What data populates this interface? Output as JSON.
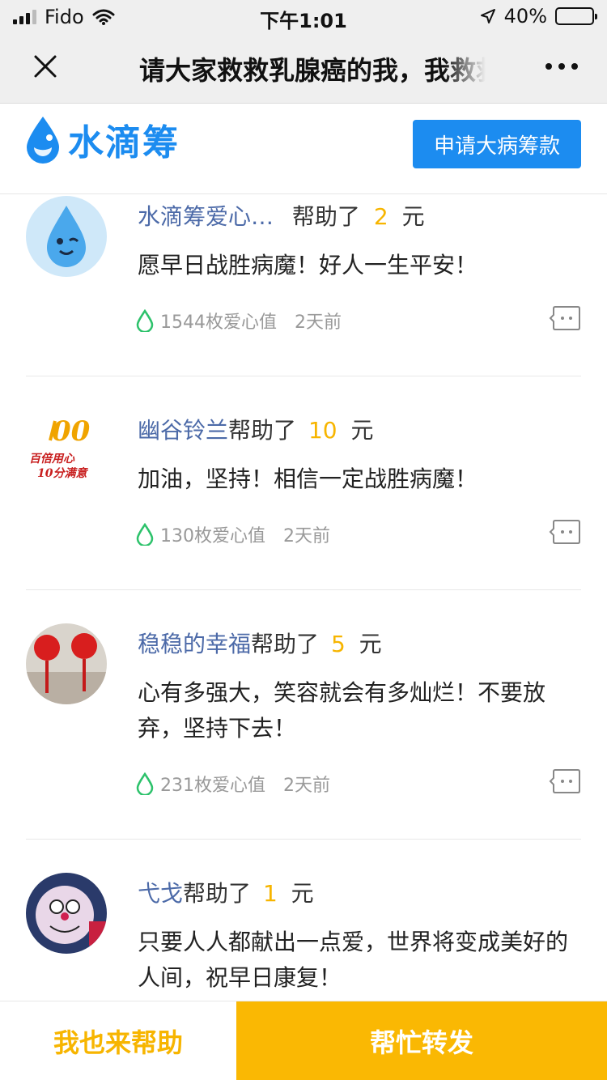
{
  "status_bar": {
    "carrier": "Fido",
    "time": "下午1:01",
    "battery": "40%",
    "battery_level": 0.4
  },
  "navbar": {
    "title": "请大家救救乳腺癌的我，我救救乳腺癌的我"
  },
  "brand": {
    "name": "水滴筹",
    "apply_button": "申请大病筹款"
  },
  "comments": [
    {
      "name": "水滴筹爱心…",
      "helped": "帮助了",
      "amount": "2",
      "unit": "元",
      "message": "愿早日战胜病魔！好人一生平安！",
      "points": "1544枚爱心值",
      "time": "2天前"
    },
    {
      "name": "幽谷铃兰",
      "helped": "帮助了",
      "amount": "10",
      "unit": "元",
      "message": "加油，坚持！相信一定战胜病魔！",
      "points": "130枚爱心值",
      "time": "2天前",
      "avatar_text_1": "百倍用心",
      "avatar_text_2": "10分满意"
    },
    {
      "name": "稳稳的幸福",
      "helped": "帮助了",
      "amount": "5",
      "unit": "元",
      "message": "心有多强大，笑容就会有多灿烂！不要放弃，坚持下去！",
      "points": "231枚爱心值",
      "time": "2天前"
    },
    {
      "name": "弋戈",
      "helped": "帮助了",
      "amount": "1",
      "unit": "元",
      "message": "只要人人都献出一点爱，世界将变成美好的人间，祝早日康复！"
    }
  ],
  "bottom_bar": {
    "help_label": "我也来帮助",
    "share_label": "帮忙转发"
  },
  "colors": {
    "brand_blue": "#1c8cf0",
    "amount_yellow": "#f7b500",
    "share_bg": "#fab803",
    "name_blue": "#4c6aa8",
    "drop_green": "#2dc26b"
  }
}
